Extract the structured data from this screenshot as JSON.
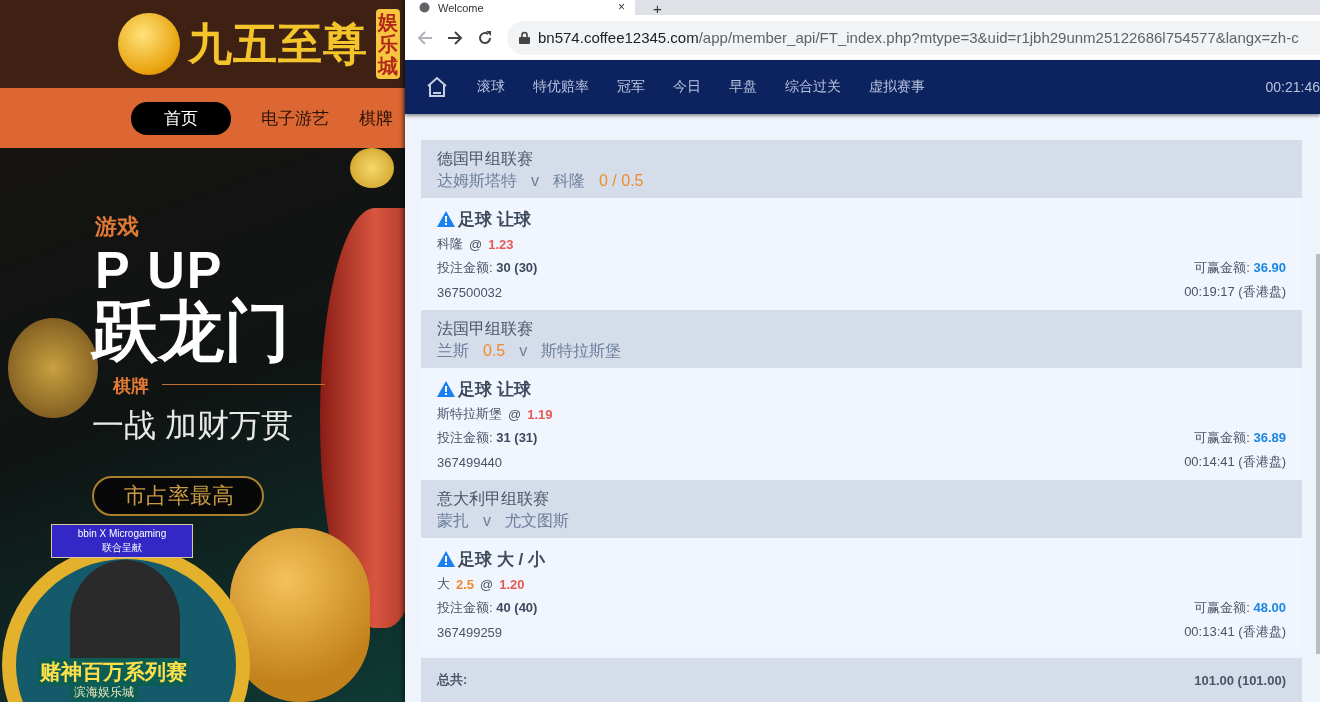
{
  "casino_site": {
    "logo_text": "九五至尊",
    "logo_badge": "娱乐城",
    "nav": [
      {
        "label": "首页",
        "selected": true
      },
      {
        "label": "电子游艺",
        "selected": false
      },
      {
        "label": "棋牌",
        "selected": false
      }
    ],
    "banner": {
      "subtitle": "游戏",
      "headline_en": "P UP",
      "headline": "跃龙门",
      "tags": "棋牌",
      "slogan": "一战  加财万贯",
      "button": "市占率最高"
    },
    "promo_badge": {
      "brand": "bbin X Microgaming",
      "caption": "联合呈献",
      "title": "赌神百万系列赛",
      "venue": "滨海娱乐城"
    }
  },
  "browser": {
    "tab": {
      "title": "Welcome",
      "close": "×"
    },
    "new_tab": "+",
    "address": {
      "host": "bn574.coffee12345.com",
      "path": "/app/member_api/FT_index.php?mtype=3&uid=r1jbh29unm25122686l754577&langx=zh-c"
    }
  },
  "nav": {
    "items": [
      "滚球",
      "特优赔率",
      "冠军",
      "今日",
      "早盘",
      "综合过关",
      "虚拟赛事"
    ],
    "clock": "00:21:46"
  },
  "bets": [
    {
      "league": "德国甲组联赛",
      "matchup": [
        {
          "kind": "team",
          "text": "达姆斯塔特"
        },
        {
          "kind": "vs",
          "text": "v"
        },
        {
          "kind": "team",
          "text": "科隆"
        },
        {
          "kind": "handicap",
          "text": "0 / 0.5"
        }
      ],
      "market": "足球 让球",
      "selection": "科隆",
      "at": "@",
      "odds": "1.23",
      "stake_label": "投注金额:",
      "stake": "30 (30)",
      "win_label": "可赢金额:",
      "win": "36.90",
      "ticket": "367500032",
      "time": "00:19:17 (香港盘)"
    },
    {
      "league": "法国甲组联赛",
      "matchup": [
        {
          "kind": "team",
          "text": "兰斯"
        },
        {
          "kind": "handicap",
          "text": "0.5"
        },
        {
          "kind": "vs",
          "text": "v"
        },
        {
          "kind": "team",
          "text": "斯特拉斯堡"
        }
      ],
      "market": "足球 让球",
      "selection": "斯特拉斯堡",
      "at": "@",
      "odds": "1.19",
      "stake_label": "投注金额:",
      "stake": "31 (31)",
      "win_label": "可赢金额:",
      "win": "36.89",
      "ticket": "367499440",
      "time": "00:14:41 (香港盘)"
    },
    {
      "league": "意大利甲组联赛",
      "matchup": [
        {
          "kind": "team",
          "text": "蒙扎"
        },
        {
          "kind": "vs",
          "text": "v"
        },
        {
          "kind": "team",
          "text": "尤文图斯"
        }
      ],
      "market": "足球 大 / 小",
      "selection": "大",
      "line": "2.5",
      "at": "@",
      "odds": "1.20",
      "stake_label": "投注金额:",
      "stake": "40 (40)",
      "win_label": "可赢金额:",
      "win": "48.00",
      "ticket": "367499259",
      "time": "00:13:41 (香港盘)"
    }
  ],
  "total": {
    "label": "总共:",
    "value": "101.00 (101.00)"
  }
}
